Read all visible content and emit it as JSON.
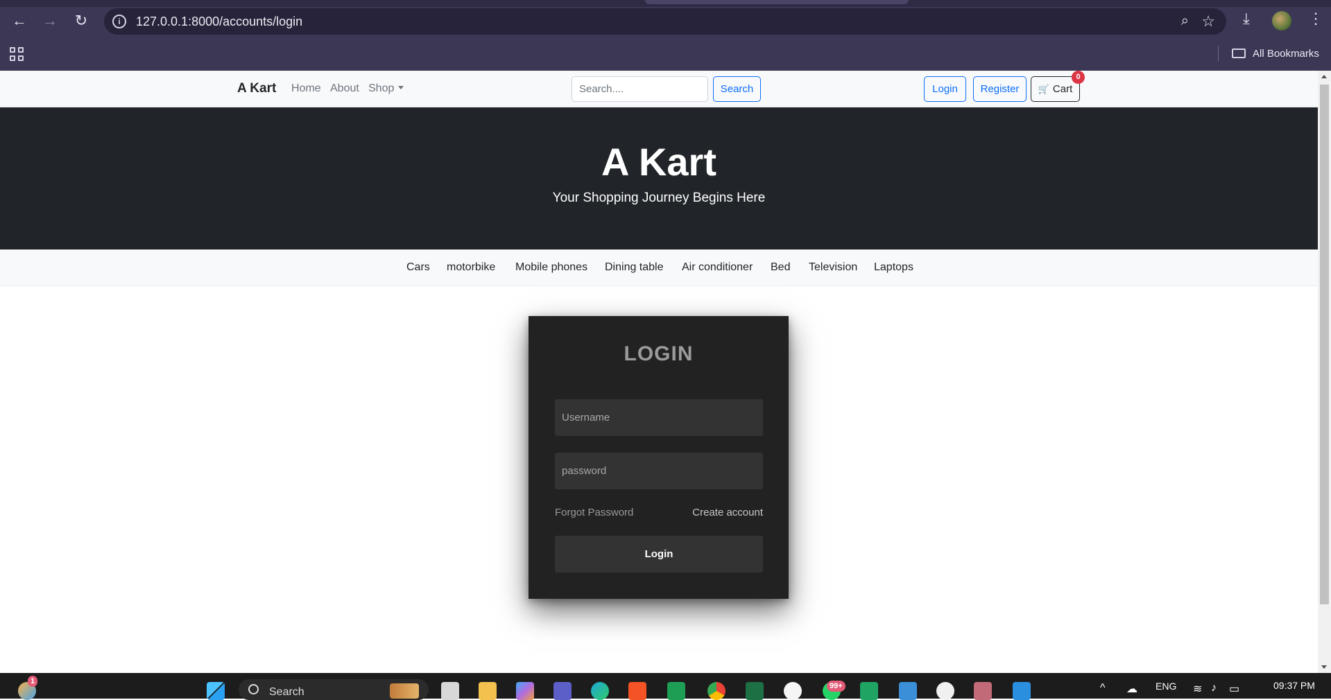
{
  "browser": {
    "url": "127.0.0.1:8000/accounts/login",
    "back_icon": "←",
    "forward_icon": "→",
    "reload_icon": "↻",
    "info_icon": "i",
    "zoom_icon": "⌕",
    "star_icon": "☆",
    "download_icon": "⤓",
    "menu_icon": "⋮",
    "all_bookmarks_label": "All Bookmarks"
  },
  "site": {
    "brand": "A Kart",
    "nav": {
      "home": "Home",
      "about": "About",
      "shop": "Shop"
    },
    "search": {
      "placeholder": "Search....",
      "button_label": "Search"
    },
    "auth": {
      "login_label": "Login",
      "register_label": "Register"
    },
    "cart": {
      "icon": "🛒",
      "label": "Cart",
      "count": "0"
    }
  },
  "hero": {
    "title": "A Kart",
    "subtitle": "Your Shopping Journey Begins Here"
  },
  "categories": [
    "Cars",
    "motorbike",
    "Mobile phones",
    "Dining table",
    "Air conditioner",
    "Bed",
    "Television",
    "Laptops"
  ],
  "login_form": {
    "title": "LOGIN",
    "username_placeholder": "Username",
    "password_placeholder": "password",
    "forgot_password": "Forgot Password",
    "create_account": "Create account",
    "submit_label": "Login"
  },
  "taskbar": {
    "search_label": "Search",
    "weather_badge": "1",
    "notification_badge": "99+",
    "language": "ENG",
    "time": "09:37 PM"
  },
  "colors": {
    "primary": "#0d6efd",
    "dark": "#212529",
    "badge": "#dc3545",
    "card": "#222222",
    "field": "#333333"
  }
}
